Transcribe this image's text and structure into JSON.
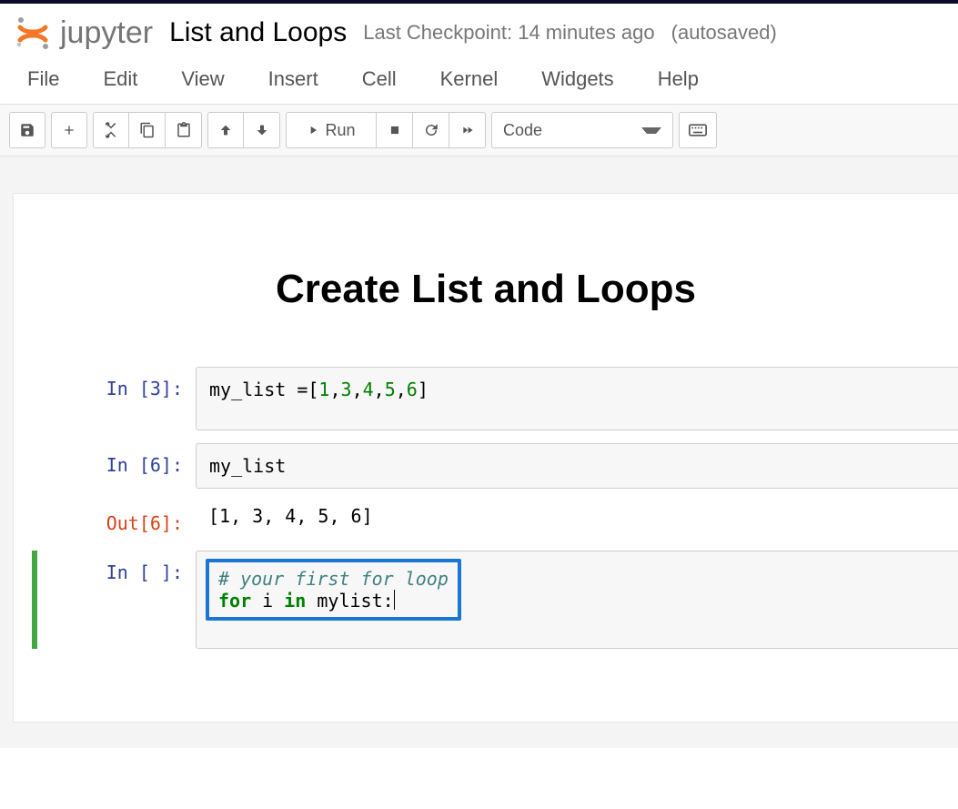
{
  "header": {
    "brand": "jupyter",
    "title": "List and Loops",
    "checkpoint": "Last Checkpoint: 14 minutes ago",
    "autosave": "(autosaved)"
  },
  "menubar": {
    "file": "File",
    "edit": "Edit",
    "view": "View",
    "insert": "Insert",
    "cell": "Cell",
    "kernel": "Kernel",
    "widgets": "Widgets",
    "help": "Help"
  },
  "toolbar": {
    "run_label": "Run",
    "celltype": "Code"
  },
  "notebook": {
    "md_heading": "Create List and Loops",
    "cell1": {
      "prompt": "In [3]:",
      "code_plain": "my_list =[1,3,4,5,6]"
    },
    "cell2": {
      "prompt_in": "In [6]:",
      "code": "my_list",
      "prompt_out": "Out[6]:",
      "output": "[1, 3, 4, 5, 6]"
    },
    "cell3": {
      "prompt": "In [ ]:",
      "comment": "# your first for loop",
      "kw_for": "for",
      "var_i": " i ",
      "kw_in": "in",
      "rest": " mylist:"
    }
  }
}
